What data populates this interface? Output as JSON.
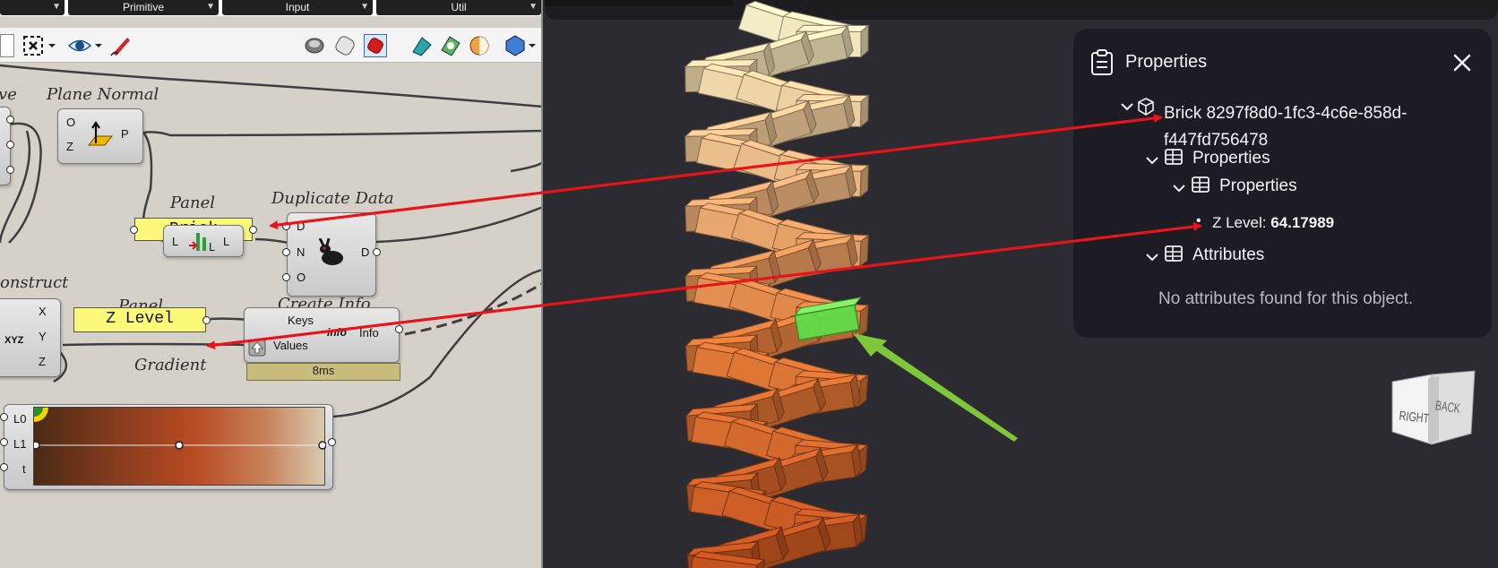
{
  "grasshopper": {
    "tabs": [
      {
        "label": "Primitive"
      },
      {
        "label": "Input"
      },
      {
        "label": "Util"
      }
    ],
    "components": {
      "curve_title": "ve",
      "plane_normal": {
        "title": "Plane Normal",
        "inputs": [
          "O",
          "Z"
        ],
        "output": "P"
      },
      "panel_brick": {
        "title": "Panel",
        "text": "Brick"
      },
      "list_length": {
        "input": "L",
        "output": "L"
      },
      "duplicate_data": {
        "title": "Duplicate Data",
        "inputs": [
          "D",
          "N",
          "O"
        ],
        "output": "D"
      },
      "construct": {
        "title": "onstruct",
        "inputs": [
          "X",
          "Y",
          "Z"
        ],
        "icon_label": "XYZ"
      },
      "panel_zlevel": {
        "title": "Panel",
        "text": "Z Level"
      },
      "create_info": {
        "title": "Create Info",
        "inputs": [
          "Keys",
          "Values"
        ],
        "icon_label": "info",
        "output": "Info",
        "timer": "8ms"
      },
      "gradient": {
        "title": "Gradient",
        "inputs": [
          "L0",
          "L1",
          "t"
        ]
      }
    }
  },
  "properties_panel": {
    "title": "Properties",
    "object_label": "Brick 8297f8d0-1fc3-4c6e-858d-",
    "object_label_line2": "f447fd756478",
    "group_1": "Properties",
    "group_2": "Properties",
    "zlevel_key": "Z Level:",
    "zlevel_value": "64.17989",
    "attributes_label": "Attributes",
    "attributes_empty": "No attributes found for this object."
  },
  "viewcube": {
    "right_label": "RIGHT",
    "back_label": "BACK"
  },
  "colors": {
    "panel_bg": "#1d1c24",
    "viewport_bg": "#2c2b31",
    "gh_canvas": "#d5d1c9",
    "annotation_red": "#e8141a",
    "annotation_green": "#7fc73a",
    "selected_brick": "#5ee04a"
  },
  "icons": [
    "clipboard-icon",
    "close-icon",
    "cube-outline-icon",
    "table-icon",
    "chevron-down-icon"
  ]
}
